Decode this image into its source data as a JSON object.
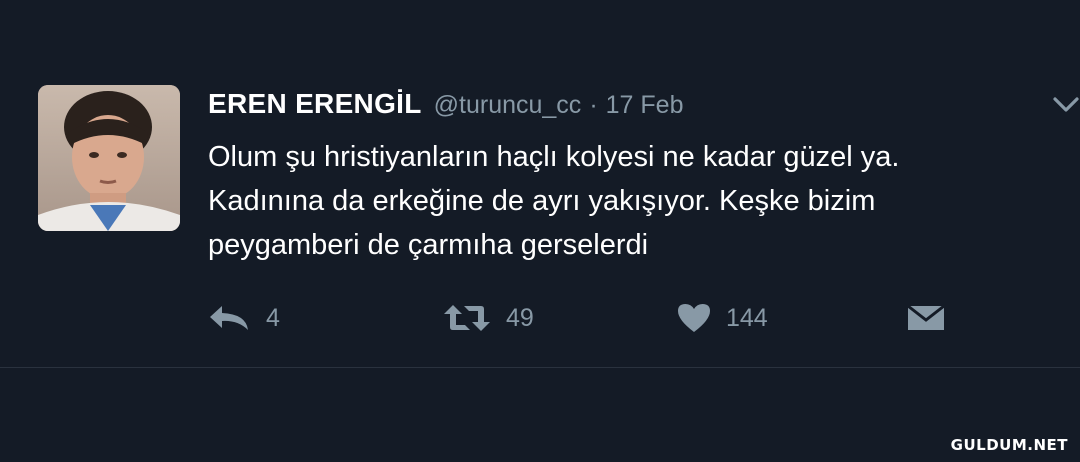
{
  "tweet": {
    "author": {
      "name": "EREN ERENGİL",
      "handle": "@turuncu_cc"
    },
    "separator": "·",
    "date": "17 Feb",
    "text_lines": [
      "Olum şu hristiyanların haçlı kolyesi ne kadar güzel ya.",
      "Kadınına da erkeğine de ayrı yakışıyor. Keşke bizim",
      "peygamberi de çarmıha gerselerdi"
    ],
    "actions": {
      "reply_count": "4",
      "retweet_count": "49",
      "like_count": "144"
    },
    "icons": {
      "reply": "reply-icon",
      "retweet": "retweet-icon",
      "like": "heart-icon",
      "message": "envelope-icon",
      "menu": "chevron-down-icon"
    }
  },
  "colors": {
    "background": "#141b26",
    "text": "#ffffff",
    "muted": "#8899a6"
  },
  "watermark": "GULDUM.NET"
}
